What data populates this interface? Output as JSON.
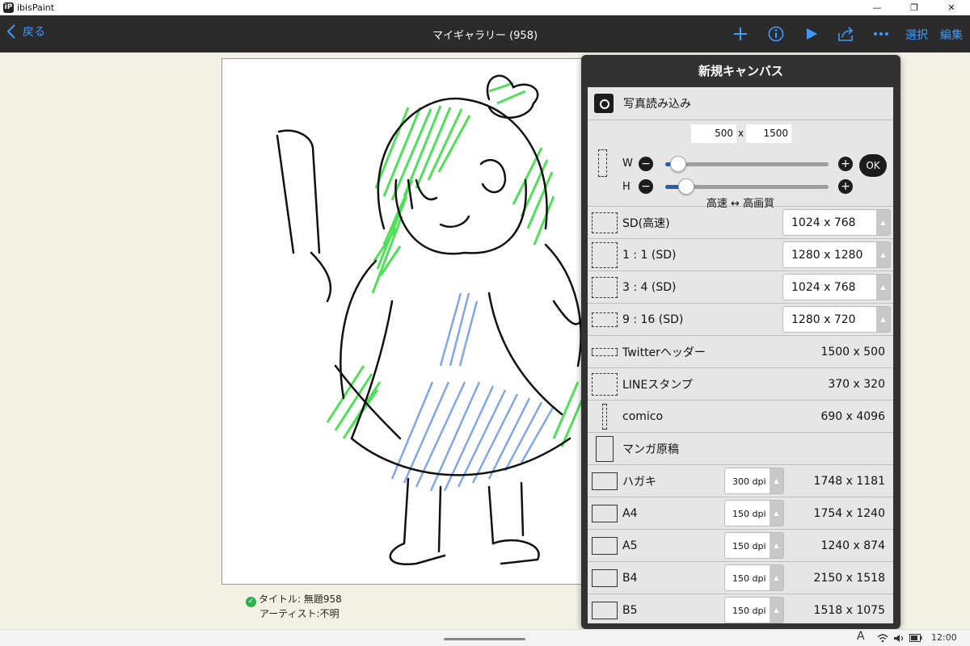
{
  "window": {
    "app_title": "ibisPaint",
    "app_icon": "iP",
    "ctrl_minimize": "—",
    "ctrl_maximize": "❐",
    "ctrl_close": "✕"
  },
  "toolbar": {
    "back_label": "戻る",
    "title": "マイギャラリー (958)",
    "select_label": "選択",
    "edit_label": "編集",
    "accent_color": "#3d9bff"
  },
  "artwork": {
    "title_line": "タイトル: 無題958",
    "artist_line": "アーティスト:不明"
  },
  "new_canvas": {
    "title": "新規キャンバス",
    "photo_import": "写真読み込み",
    "custom": {
      "width": "500",
      "x_label": "x",
      "height": "1500",
      "w_label": "W",
      "h_label": "H",
      "minus": "−",
      "plus": "+",
      "w_slider_fraction": 0.04,
      "h_slider_fraction": 0.1,
      "ok_label": "OK",
      "quality_label": "高速 ↔ 高画質"
    },
    "presets": [
      {
        "label": "SD(高速)",
        "value": "1024 x 768",
        "kind": "select"
      },
      {
        "label": "1 : 1 (SD)",
        "value": "1280 x 1280",
        "kind": "select"
      },
      {
        "label": "3 : 4 (SD)",
        "value": "1024 x 768",
        "kind": "select"
      },
      {
        "label": "9 : 16 (SD)",
        "value": "1280 x 720",
        "kind": "select"
      },
      {
        "label": "Twitterヘッダー",
        "value": "1500 x 500",
        "kind": "text"
      },
      {
        "label": "LINEスタンプ",
        "value": "370 x 320",
        "kind": "text"
      },
      {
        "label": "comico",
        "value": "690 x 4096",
        "kind": "text"
      },
      {
        "label": "マンガ原稿",
        "value": "",
        "kind": "none"
      },
      {
        "label": "ハガキ",
        "dpi": "300 dpi",
        "value": "1748 x 1181",
        "kind": "dpi"
      },
      {
        "label": "A4",
        "dpi": "150 dpi",
        "value": "1754 x 1240",
        "kind": "dpi"
      },
      {
        "label": "A5",
        "dpi": "150 dpi",
        "value": "1240 x 874",
        "kind": "dpi"
      },
      {
        "label": "B4",
        "dpi": "150 dpi",
        "value": "2150 x 1518",
        "kind": "dpi"
      },
      {
        "label": "B5",
        "dpi": "150 dpi",
        "value": "1518 x 1075",
        "kind": "dpi"
      }
    ],
    "select_arrow": "▲"
  },
  "taskbar": {
    "ime_indicator": "A",
    "clock": "12:00"
  }
}
